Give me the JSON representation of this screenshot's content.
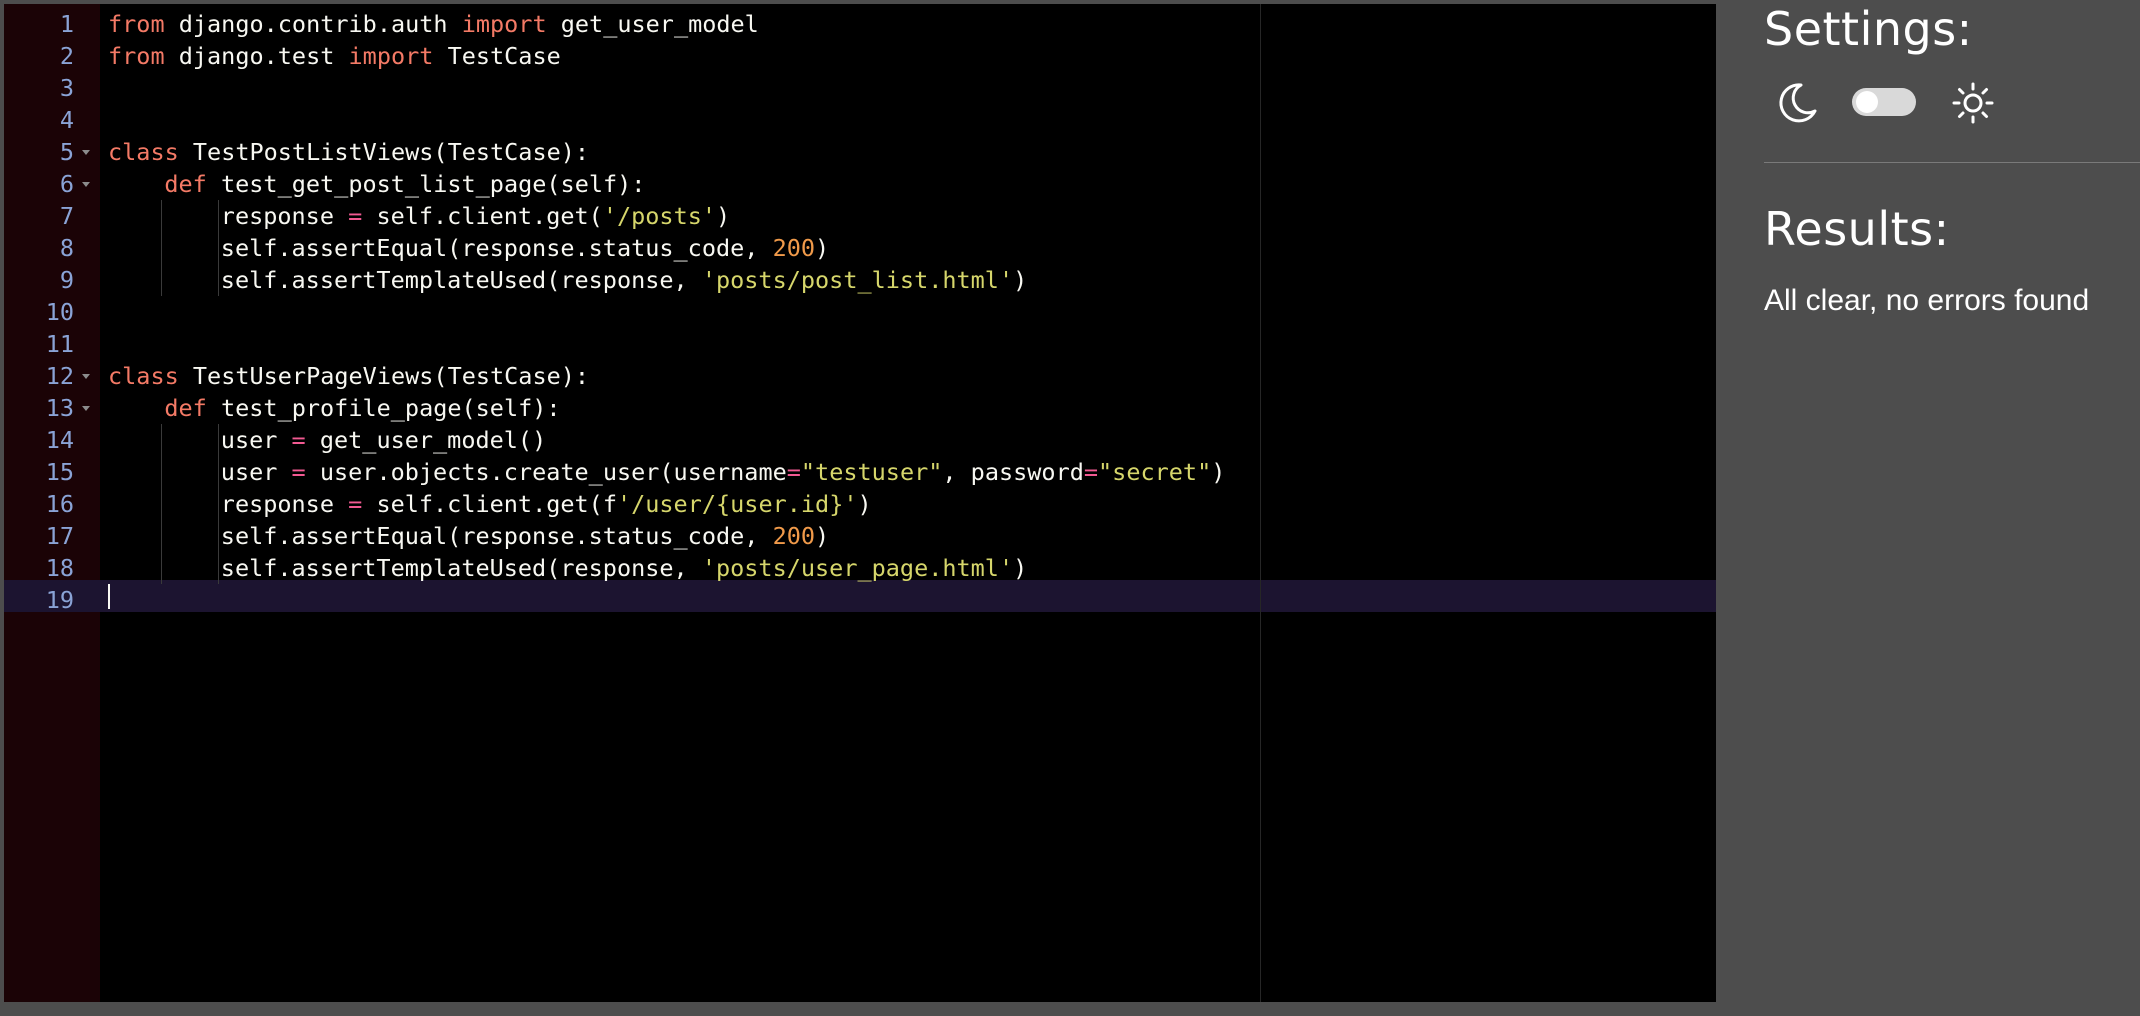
{
  "editor": {
    "lines": [
      {
        "n": "1",
        "fold": false,
        "indent": 0,
        "tokens": [
          {
            "t": "from",
            "c": "kw"
          },
          {
            "t": " django.contrib.auth ",
            "c": "cls"
          },
          {
            "t": "import",
            "c": "kw"
          },
          {
            "t": " get_user_model",
            "c": "cls"
          }
        ]
      },
      {
        "n": "2",
        "fold": false,
        "indent": 0,
        "tokens": [
          {
            "t": "from",
            "c": "kw"
          },
          {
            "t": " django.test ",
            "c": "cls"
          },
          {
            "t": "import",
            "c": "kw"
          },
          {
            "t": " TestCase",
            "c": "cls"
          }
        ]
      },
      {
        "n": "3",
        "fold": false,
        "indent": 0,
        "tokens": []
      },
      {
        "n": "4",
        "fold": false,
        "indent": 0,
        "tokens": []
      },
      {
        "n": "5",
        "fold": true,
        "indent": 0,
        "tokens": [
          {
            "t": "class",
            "c": "kw"
          },
          {
            "t": " TestPostListViews(TestCase):",
            "c": "cls"
          }
        ]
      },
      {
        "n": "6",
        "fold": true,
        "indent": 1,
        "tokens": [
          {
            "t": "def",
            "c": "kw"
          },
          {
            "t": " test_get_post_list_page(self):",
            "c": "cls"
          }
        ]
      },
      {
        "n": "7",
        "fold": false,
        "indent": 2,
        "tokens": [
          {
            "t": "response ",
            "c": "cls"
          },
          {
            "t": "=",
            "c": "op"
          },
          {
            "t": " self.client.get(",
            "c": "cls"
          },
          {
            "t": "'/posts'",
            "c": "str"
          },
          {
            "t": ")",
            "c": "cls"
          }
        ]
      },
      {
        "n": "8",
        "fold": false,
        "indent": 2,
        "tokens": [
          {
            "t": "self.assertEqual(response.status_code, ",
            "c": "cls"
          },
          {
            "t": "200",
            "c": "num"
          },
          {
            "t": ")",
            "c": "cls"
          }
        ]
      },
      {
        "n": "9",
        "fold": false,
        "indent": 2,
        "tokens": [
          {
            "t": "self.assertTemplateUsed(response, ",
            "c": "cls"
          },
          {
            "t": "'posts/post_list.html'",
            "c": "str"
          },
          {
            "t": ")",
            "c": "cls"
          }
        ]
      },
      {
        "n": "10",
        "fold": false,
        "indent": 0,
        "tokens": []
      },
      {
        "n": "11",
        "fold": false,
        "indent": 0,
        "tokens": []
      },
      {
        "n": "12",
        "fold": true,
        "indent": 0,
        "tokens": [
          {
            "t": "class",
            "c": "kw"
          },
          {
            "t": " TestUserPageViews(TestCase):",
            "c": "cls"
          }
        ]
      },
      {
        "n": "13",
        "fold": true,
        "indent": 1,
        "tokens": [
          {
            "t": "def",
            "c": "kw"
          },
          {
            "t": " test_profile_page(self):",
            "c": "cls"
          }
        ]
      },
      {
        "n": "14",
        "fold": false,
        "indent": 2,
        "tokens": [
          {
            "t": "user ",
            "c": "cls"
          },
          {
            "t": "=",
            "c": "op"
          },
          {
            "t": " get_user_model()",
            "c": "cls"
          }
        ]
      },
      {
        "n": "15",
        "fold": false,
        "indent": 2,
        "tokens": [
          {
            "t": "user ",
            "c": "cls"
          },
          {
            "t": "=",
            "c": "op"
          },
          {
            "t": " user.objects.create_user(username",
            "c": "cls"
          },
          {
            "t": "=",
            "c": "op"
          },
          {
            "t": "\"testuser\"",
            "c": "str"
          },
          {
            "t": ", password",
            "c": "cls"
          },
          {
            "t": "=",
            "c": "op"
          },
          {
            "t": "\"secret\"",
            "c": "str"
          },
          {
            "t": ")",
            "c": "cls"
          }
        ]
      },
      {
        "n": "16",
        "fold": false,
        "indent": 2,
        "tokens": [
          {
            "t": "response ",
            "c": "cls"
          },
          {
            "t": "=",
            "c": "op"
          },
          {
            "t": " self.client.get(f",
            "c": "cls"
          },
          {
            "t": "'/user/{user.id}'",
            "c": "str"
          },
          {
            "t": ")",
            "c": "cls"
          }
        ]
      },
      {
        "n": "17",
        "fold": false,
        "indent": 2,
        "tokens": [
          {
            "t": "self.assertEqual(response.status_code, ",
            "c": "cls"
          },
          {
            "t": "200",
            "c": "num"
          },
          {
            "t": ")",
            "c": "cls"
          }
        ]
      },
      {
        "n": "18",
        "fold": false,
        "indent": 2,
        "tokens": [
          {
            "t": "self.assertTemplateUsed(response, ",
            "c": "cls"
          },
          {
            "t": "'posts/user_page.html'",
            "c": "str"
          },
          {
            "t": ")",
            "c": "cls"
          }
        ]
      },
      {
        "n": "19",
        "fold": false,
        "indent": 0,
        "tokens": []
      }
    ],
    "active_line": "19"
  },
  "sidebar": {
    "settings_title": "Settings:",
    "theme": {
      "dark_icon": "moon-icon",
      "light_icon": "sun-icon",
      "toggle_on": false
    },
    "results_title": "Results:",
    "results_text": "All clear, no errors found"
  },
  "colors": {
    "background": "#4d4d4d",
    "editor_bg": "#000000",
    "gutter_bg": "#1b0306",
    "keyword": "#f47a66",
    "string": "#d6d66b",
    "number": "#f09a4a",
    "operator": "#f25a92",
    "line_number": "#8aa3d6"
  }
}
